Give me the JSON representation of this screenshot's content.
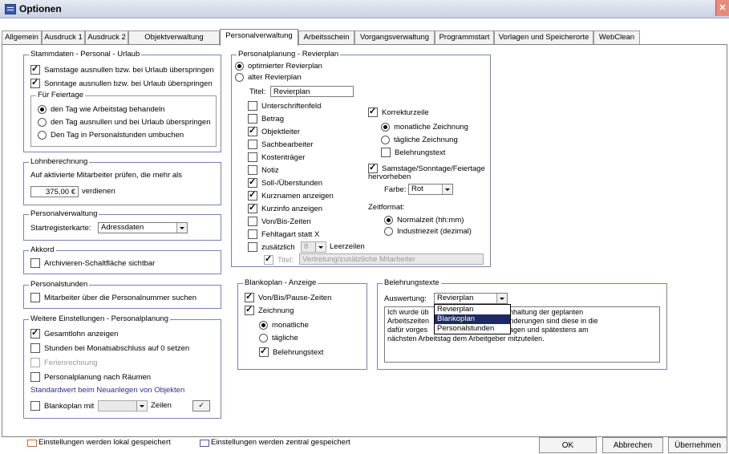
{
  "window": {
    "title": "Optionen",
    "close": "✕"
  },
  "tabs": [
    "Allgemein",
    "Ausdruck 1",
    "Ausdruck 2",
    "Objektverwaltung",
    "Personalverwaltung",
    "Arbeitsschein",
    "Vorgangsverwaltung",
    "Programmstart",
    "Vorlagen und Speicherorte",
    "WebClean"
  ],
  "active_tab": "Personalverwaltung",
  "stammdaten": {
    "title": "Stammdaten - Personal - Urlaub",
    "samstage": "Samstage ausnullen bzw. bei Urlaub überspringen",
    "sonntage": "Sonntage ausnullen bzw. bei Urlaub überspringen",
    "feiertage_title": "Für Feiertage",
    "feiertag_opt1": "den Tag wie Arbeitstag behandeln",
    "feiertag_opt2": "den Tag ausnullen und bei Urlaub überspringen",
    "feiertag_opt3": "Den Tag in Personalstunden umbuchen"
  },
  "lohn": {
    "title": "Lohnberechnung",
    "text": "Auf aktivierte Mitarbeiter prüfen, die mehr als",
    "value": "375,00 €",
    "suffix": "verdienen"
  },
  "personalverwaltung": {
    "title": "Personalverwaltung",
    "label": "Startregisterkarte:",
    "value": "Adressdaten"
  },
  "akkord": {
    "title": "Akkord",
    "checkbox": "Archivieren-Schaltfläche sichtbar"
  },
  "personalstunden": {
    "title": "Personalstunden",
    "checkbox": "Mitarbeiter über die Personalnummer suchen"
  },
  "weitere": {
    "title": "Weitere Einstellungen - Personalplanung",
    "gesamtlohn": "Gesamtlohn anzeigen",
    "stunden": "Stunden bei Monatsabschluss auf 0 setzen",
    "ferien": "Ferienrechnung",
    "raeume": "Personalplanung nach Räumen",
    "standard_title": "Standardwert beim Neuanlegen von Objekten",
    "blanko": "Blankoplan mit",
    "zeilen": "Zeilen",
    "check": "✓"
  },
  "revierplan": {
    "title": "Personalplanung - Revierplan",
    "opt1": "optimierter Revierplan",
    "opt2": "alter Revierplan",
    "titel_label": "Titel:",
    "titel_value": "Revierplan",
    "items": [
      "Unterschriftenfeld",
      "Betrag",
      "Objektleiter",
      "Sachbearbeiter",
      "Kostenträger",
      "Notiz",
      "Soll-/Überstunden",
      "Kurznamen anzeigen",
      "Kurzinfo anzeigen",
      "Von/Bis-Zeiten",
      "Fehltagart statt X"
    ],
    "zusaetzlich": "zusätzlich",
    "zusaetzlich_value": "8",
    "leerzeilen": "Leerzeilen",
    "titel2_label": "Titel:",
    "titel2_value": "Vertretung/zusätzliche Mitarbeiter",
    "korrektur": "Korrekturzeile",
    "monatlich": "monatliche Zeichnung",
    "taeglich": "tägliche Zeichnung",
    "belehrung": "Belehrungstext",
    "samstage": "Samstage/Sonntage/Feiertage",
    "hervorheben": "hervorheben",
    "farbe_label": "Farbe:",
    "farbe_value": "Rot",
    "zeitformat": "Zeitformat:",
    "normal": "Normalzeit (hh:mm)",
    "industrie": "Industriezeit (dezimal)"
  },
  "blankoplan": {
    "title": "Blankoplan - Anzeige",
    "vonbis": "Von/Bis/Pause-Zeiten",
    "zeichnung": "Zeichnung",
    "monatliche": "monatliche",
    "taegliche": "tägliche",
    "belehrung": "Belehrungstext"
  },
  "belehrungstexte": {
    "title": "Belehrungstexte",
    "label": "Auswertung:",
    "value": "Revierplan",
    "options": [
      "Revierplan",
      "Blankoplan",
      "Personalstunden"
    ],
    "selected_option": "Blankoplan",
    "text_line1a": "Ich wurde üb",
    "text_line1b": "er Einhaltung der geplanten",
    "text_line2a": "Arbeitszeiten",
    "text_line2b": "en Änderungen sind diese in die",
    "text_line3a": "dafür vorges",
    "text_line3b": "nzutragen und spätestens am",
    "text_line4": "nächsten Arbeitstag dem Arbeitgeber mitzuteilen."
  },
  "footer": {
    "lokal": "Einstellungen werden lokal gespeichert",
    "zentral": "Einstellungen werden zentral gespeichert",
    "ok": "OK",
    "abbrechen": "Abbrechen",
    "uebernehmen": "Übernehmen"
  },
  "colors": {
    "lokal_border": "#d06a2a",
    "zentral_border": "#4a55b0",
    "group_border": "#7b7fb5"
  }
}
